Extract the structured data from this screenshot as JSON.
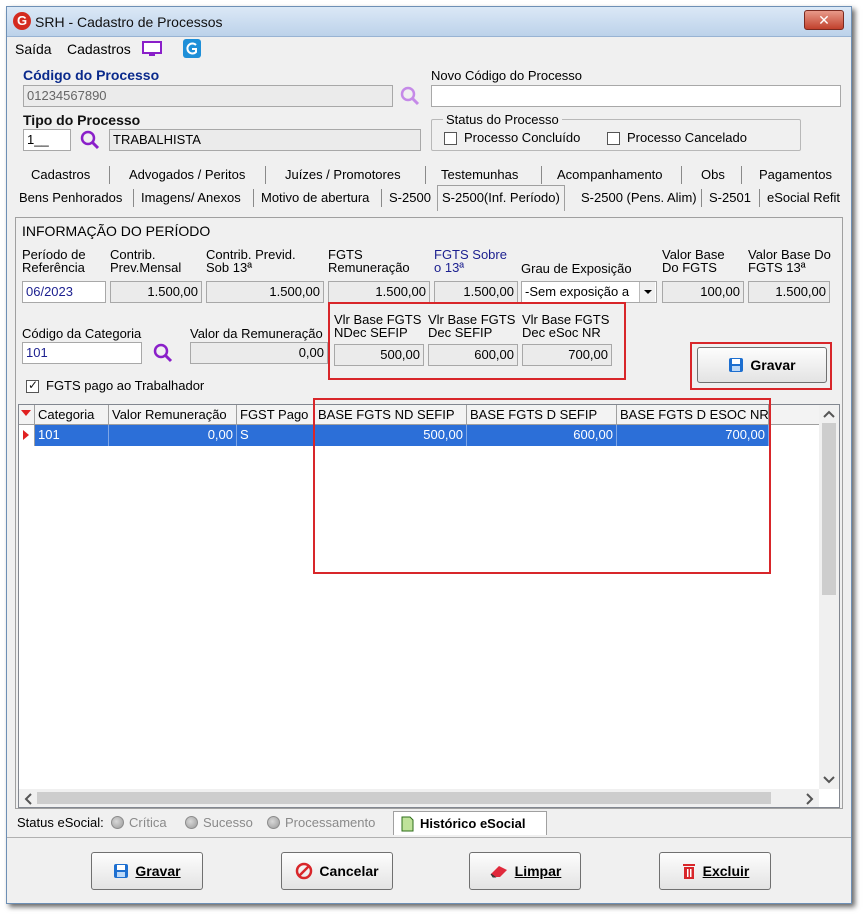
{
  "window": {
    "title": "SRH - Cadastro de Processos",
    "close_glyph": "✕",
    "app_icon_letter": "G"
  },
  "menu": {
    "items": [
      "Saída",
      "Cadastros"
    ]
  },
  "header": {
    "codigo_label": "Código do Processo",
    "codigo_value": "01234567890",
    "novo_codigo_label": "Novo Código do Processo",
    "novo_codigo_value": "",
    "tipo_label": "Tipo do Processo",
    "tipo_code": "1__",
    "tipo_name": "TRABALHISTA",
    "status_label": "Status do Processo",
    "concluido_label": "Processo Concluído",
    "cancelado_label": "Processo Cancelado"
  },
  "tabs_row1": [
    "Cadastros",
    "Advogados / Peritos",
    "Juízes / Promotores",
    "Testemunhas",
    "Acompanhamento",
    "Obs",
    "Pagamentos"
  ],
  "tabs_row2": [
    "Bens Penhorados",
    "Imagens/ Anexos",
    "Motivo de abertura",
    "S-2500",
    "S-2500(Inf. Período)",
    "S-2500 (Pens. Alim)",
    "S-2501",
    "eSocial Refit"
  ],
  "period": {
    "section_title": "INFORMAÇÃO DO PERÍODO",
    "periodo_label": "Período de Referência",
    "periodo_value": "06/2023",
    "contrib_mensal_label": "Contrib. Prev.Mensal",
    "contrib_mensal_value": "1.500,00",
    "contrib_13_label": "Contrib. Previd. Sob 13ª",
    "contrib_13_value": "1.500,00",
    "fgts_rem_label": "FGTS Remuneração",
    "fgts_rem_value": "1.500,00",
    "fgts_13_label": "FGTS Sobre o 13ª",
    "fgts_13_value": "1.500,00",
    "grau_label": "Grau de Exposição",
    "grau_value": "-Sem exposição a",
    "vb_fgts_label": "Valor Base Do FGTS",
    "vb_fgts_value": "100,00",
    "vb_fgts13_label": "Valor Base Do FGTS 13ª",
    "vb_fgts13_value": "1.500,00",
    "categoria_label": "Código da Categoria",
    "categoria_value": "101",
    "remuneracao_label": "Valor da Remuneração",
    "remuneracao_value": "0,00",
    "vlr_ndec_label": "Vlr Base FGTS NDec SEFIP",
    "vlr_ndec_value": "500,00",
    "vlr_dec_label": "Vlr Base FGTS Dec SEFIP",
    "vlr_dec_value": "600,00",
    "vlr_esoc_label": "Vlr Base FGTS Dec eSoc NR",
    "vlr_esoc_value": "700,00",
    "gravar_label": "Gravar",
    "fgts_pago_label": "FGTS pago ao Trabalhador"
  },
  "grid": {
    "columns": [
      "Categoria",
      "Valor Remuneração",
      "FGST Pago",
      "BASE FGTS ND SEFIP",
      "BASE FGTS D SEFIP",
      "BASE FGTS D ESOC NR"
    ],
    "rows": [
      [
        "101",
        "0,00",
        "S",
        "500,00",
        "600,00",
        "700,00"
      ]
    ]
  },
  "status": {
    "label": "Status eSocial:",
    "critica": "Crítica",
    "sucesso": "Sucesso",
    "processamento": "Processamento",
    "historico": "Histórico eSocial"
  },
  "footer": {
    "gravar": "Gravar",
    "cancelar": "Cancelar",
    "limpar": "Limpar",
    "excluir": "Excluir"
  },
  "colors": {
    "selection": "#2c6fd8",
    "highlight_red": "#d8262a",
    "label_blue": "#0a2a8c",
    "icon_purple": "#8a1fc9"
  }
}
